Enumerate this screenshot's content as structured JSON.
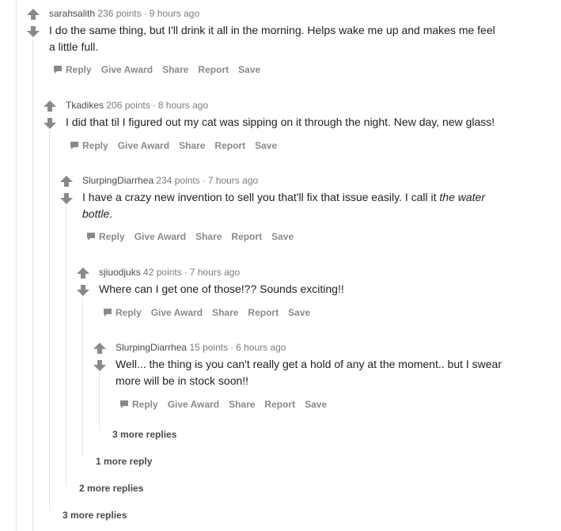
{
  "colors": {
    "vote_arrow": "#878a8c",
    "thread_line": "#e3e5e7",
    "meta_text": "#7c7c7c"
  },
  "comments": [
    {
      "author": "sarahsalith",
      "points": "236 points",
      "time": "9 hours ago",
      "text_lines": [
        "I do the same thing, but I'll drink it all in the morning. Helps wake me up and makes me feel",
        "a little full."
      ],
      "actions": {
        "reply": "Reply",
        "award": "Give Award",
        "share": "Share",
        "report": "Report",
        "save": "Save"
      }
    },
    {
      "author": "Tkadikes",
      "points": "206 points",
      "time": "8 hours ago",
      "text_lines": [
        "I did that til I figured out my cat was sipping on it through the night. New day, new glass!"
      ],
      "actions": {
        "reply": "Reply",
        "award": "Give Award",
        "share": "Share",
        "report": "Report",
        "save": "Save"
      }
    },
    {
      "author": "SlurpingDiarrhea",
      "points": "234 points",
      "time": "7 hours ago",
      "text_prefix": "I have a crazy new invention to sell you that'll fix that issue easily. I call it ",
      "text_em1": "the water",
      "text_em2": "bottle",
      "text_suffix": ".",
      "actions": {
        "reply": "Reply",
        "award": "Give Award",
        "share": "Share",
        "report": "Report",
        "save": "Save"
      }
    },
    {
      "author": "sjiuodjuks",
      "points": "42 points",
      "time": "7 hours ago",
      "text_lines": [
        "Where can I get one of those!?? Sounds exciting!!"
      ],
      "actions": {
        "reply": "Reply",
        "award": "Give Award",
        "share": "Share",
        "report": "Report",
        "save": "Save"
      }
    },
    {
      "author": "SlurpingDiarrhea",
      "points": "15 points",
      "time": "6 hours ago",
      "text_lines": [
        "Well... the thing is you can't really get a hold of any at the moment.. but I swear",
        "more will be in stock soon!!"
      ],
      "actions": {
        "reply": "Reply",
        "award": "Give Award",
        "share": "Share",
        "report": "Report",
        "save": "Save"
      }
    }
  ],
  "more_replies": [
    "3 more replies",
    "1 more reply",
    "2 more replies",
    "3 more replies"
  ]
}
